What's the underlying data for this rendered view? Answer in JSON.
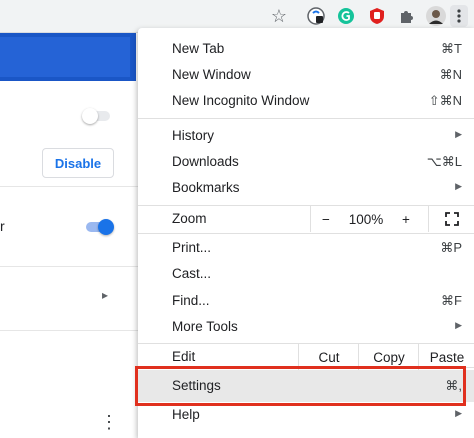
{
  "menu": {
    "items": [
      {
        "label": "New Tab",
        "shortcut": "⌘T"
      },
      {
        "label": "New Window",
        "shortcut": "⌘N"
      },
      {
        "label": "New Incognito Window",
        "shortcut": "⇧⌘N"
      },
      {
        "label": "History",
        "submenu": true
      },
      {
        "label": "Downloads",
        "shortcut": "⌥⌘L"
      },
      {
        "label": "Bookmarks",
        "submenu": true
      },
      {
        "label": "Print...",
        "shortcut": "⌘P"
      },
      {
        "label": "Cast..."
      },
      {
        "label": "Find...",
        "shortcut": "⌘F"
      },
      {
        "label": "More Tools",
        "submenu": true
      },
      {
        "label": "Settings",
        "shortcut": "⌘,"
      },
      {
        "label": "Help",
        "submenu": true
      }
    ],
    "zoom": {
      "label": "Zoom",
      "minus": "−",
      "value": "100%",
      "plus": "+",
      "fullscreen_icon": "fullscreen-icon"
    },
    "edit": {
      "label": "Edit",
      "cut": "Cut",
      "copy": "Copy",
      "paste": "Paste"
    },
    "highlight_color": "#e0301e"
  },
  "page": {
    "disable_button": "Disable",
    "row_fragment": "r"
  },
  "colors": {
    "accent": "#1a73e8",
    "banner": "#1a56c6"
  },
  "icons": [
    "star-icon",
    "tracker-extension-icon",
    "grammarly-icon",
    "shield-extension-icon",
    "puzzle-icon",
    "avatar",
    "kebab-menu-icon"
  ]
}
